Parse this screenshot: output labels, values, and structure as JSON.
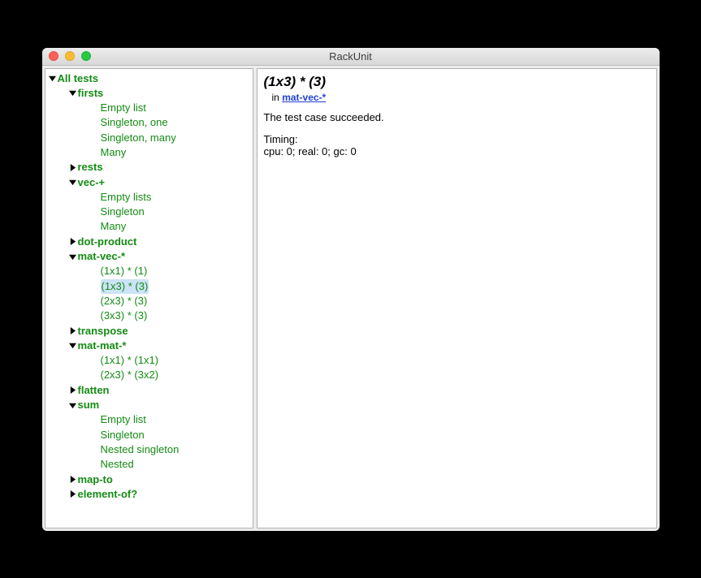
{
  "window": {
    "title": "RackUnit"
  },
  "colors": {
    "success": "#148b14",
    "link": "#1f3fd8",
    "selection": "#cce3f8"
  },
  "tree": [
    {
      "depth": 0,
      "arrow": "down",
      "bold": true,
      "label": "All tests"
    },
    {
      "depth": 1,
      "arrow": "down",
      "bold": true,
      "label": "firsts"
    },
    {
      "depth": 2,
      "arrow": "none",
      "bold": false,
      "label": "Empty list"
    },
    {
      "depth": 2,
      "arrow": "none",
      "bold": false,
      "label": "Singleton, one"
    },
    {
      "depth": 2,
      "arrow": "none",
      "bold": false,
      "label": "Singleton, many"
    },
    {
      "depth": 2,
      "arrow": "none",
      "bold": false,
      "label": "Many"
    },
    {
      "depth": 1,
      "arrow": "right",
      "bold": true,
      "label": "rests"
    },
    {
      "depth": 1,
      "arrow": "down",
      "bold": true,
      "label": "vec-+"
    },
    {
      "depth": 2,
      "arrow": "none",
      "bold": false,
      "label": "Empty lists"
    },
    {
      "depth": 2,
      "arrow": "none",
      "bold": false,
      "label": "Singleton"
    },
    {
      "depth": 2,
      "arrow": "none",
      "bold": false,
      "label": "Many"
    },
    {
      "depth": 1,
      "arrow": "right",
      "bold": true,
      "label": "dot-product"
    },
    {
      "depth": 1,
      "arrow": "down",
      "bold": true,
      "label": "mat-vec-*"
    },
    {
      "depth": 2,
      "arrow": "none",
      "bold": false,
      "label": "(1x1) * (1)"
    },
    {
      "depth": 2,
      "arrow": "none",
      "bold": false,
      "label": "(1x3) * (3)",
      "selected": true
    },
    {
      "depth": 2,
      "arrow": "none",
      "bold": false,
      "label": "(2x3) * (3)"
    },
    {
      "depth": 2,
      "arrow": "none",
      "bold": false,
      "label": "(3x3) * (3)"
    },
    {
      "depth": 1,
      "arrow": "right",
      "bold": true,
      "label": "transpose"
    },
    {
      "depth": 1,
      "arrow": "down",
      "bold": true,
      "label": "mat-mat-*"
    },
    {
      "depth": 2,
      "arrow": "none",
      "bold": false,
      "label": "(1x1) * (1x1)"
    },
    {
      "depth": 2,
      "arrow": "none",
      "bold": false,
      "label": "(2x3) * (3x2)"
    },
    {
      "depth": 1,
      "arrow": "right",
      "bold": true,
      "label": "flatten"
    },
    {
      "depth": 1,
      "arrow": "down",
      "bold": true,
      "label": "sum"
    },
    {
      "depth": 2,
      "arrow": "none",
      "bold": false,
      "label": "Empty list"
    },
    {
      "depth": 2,
      "arrow": "none",
      "bold": false,
      "label": "Singleton"
    },
    {
      "depth": 2,
      "arrow": "none",
      "bold": false,
      "label": "Nested singleton"
    },
    {
      "depth": 2,
      "arrow": "none",
      "bold": false,
      "label": "Nested"
    },
    {
      "depth": 1,
      "arrow": "right",
      "bold": true,
      "label": "map-to"
    },
    {
      "depth": 1,
      "arrow": "right",
      "bold": true,
      "label": "element-of?"
    }
  ],
  "detail": {
    "title": "(1x3) * (3)",
    "in_prefix": "in ",
    "in_link": "mat-vec-*",
    "result": "The test case succeeded.",
    "timing_label": "Timing:",
    "timing_value": "cpu: 0; real: 0; gc: 0"
  }
}
